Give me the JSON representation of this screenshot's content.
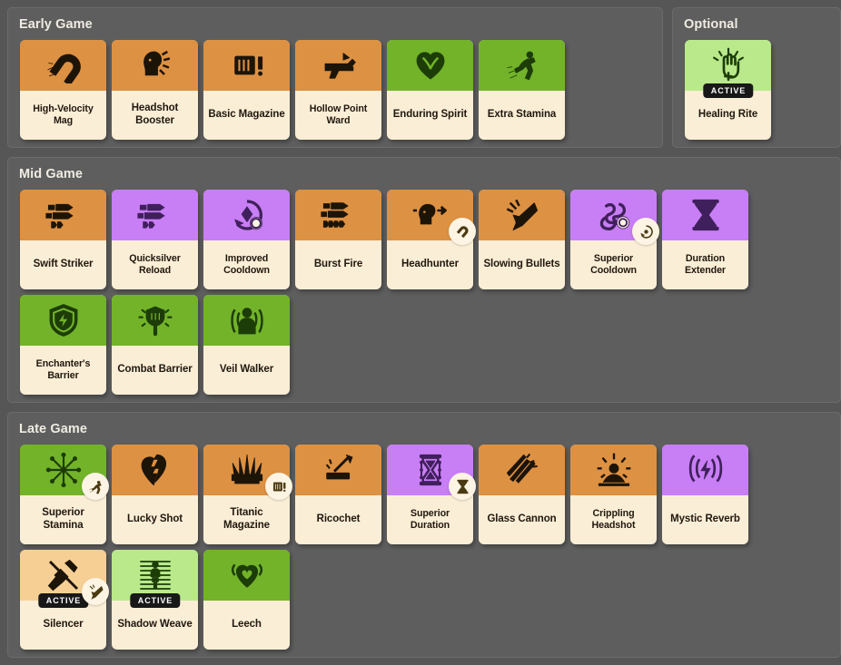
{
  "theme": {
    "page_bg": "#565656",
    "panel_bg": "#5e5e5e",
    "card_body": "#fbeed6",
    "orange": "#dd9142",
    "orange_light": "#f6cf94",
    "green": "#72b32a",
    "green_light": "#b9e98a",
    "purple": "#c87ef5",
    "active_badge_bg": "#181818",
    "title_color": "#f0ece2"
  },
  "active_badge_label": "ACTIVE",
  "sections": [
    {
      "title": "Early Game",
      "cards": [
        {
          "label": "High-Velocity Mag",
          "color": "orange",
          "icon": "magnet-icon",
          "active": false,
          "badge": null
        },
        {
          "label": "Headshot Booster",
          "color": "orange",
          "icon": "head-impact-icon",
          "active": false,
          "badge": null
        },
        {
          "label": "Basic Magazine",
          "color": "orange",
          "icon": "magazine-icon",
          "active": false,
          "badge": null
        },
        {
          "label": "Hollow Point Ward",
          "color": "orange",
          "icon": "pistol-icon",
          "active": false,
          "badge": null
        },
        {
          "label": "Enduring Spirit",
          "color": "green",
          "icon": "heart-icon",
          "active": false,
          "badge": null
        },
        {
          "label": "Extra Stamina",
          "color": "green",
          "icon": "sprint-icon",
          "active": false,
          "badge": null
        }
      ]
    },
    {
      "title": "Optional",
      "cards": [
        {
          "label": "Healing Rite",
          "color": "green_light",
          "icon": "healing-hand-icon",
          "active": true,
          "badge": null
        }
      ]
    },
    {
      "title": "Mid Game",
      "cards": [
        {
          "label": "Swift Striker",
          "color": "orange",
          "icon": "bullets-icon",
          "active": false,
          "badge": null
        },
        {
          "label": "Quicksilver Reload",
          "color": "purple",
          "icon": "bullets-icon",
          "active": false,
          "badge": null
        },
        {
          "label": "Improved Cooldown",
          "color": "purple",
          "icon": "cooldown-icon",
          "active": false,
          "badge": null
        },
        {
          "label": "Burst Fire",
          "color": "orange",
          "icon": "burst-bullets-icon",
          "active": false,
          "badge": null
        },
        {
          "label": "Headhunter",
          "color": "orange",
          "icon": "head-target-icon",
          "active": false,
          "badge": "magnet-icon"
        },
        {
          "label": "Slowing Bullets",
          "color": "orange",
          "icon": "slow-bullet-icon",
          "active": false,
          "badge": null
        },
        {
          "label": "Superior Cooldown",
          "color": "purple",
          "icon": "swirl-icon",
          "active": false,
          "badge": "cooldown-icon"
        },
        {
          "label": "Duration Extender",
          "color": "purple",
          "icon": "hourglass-icon",
          "active": false,
          "badge": null
        },
        {
          "label": "Enchanter's Barrier",
          "color": "green",
          "icon": "shield-bolt-icon",
          "active": false,
          "badge": null
        },
        {
          "label": "Combat Barrier",
          "color": "green",
          "icon": "radiant-shield-icon",
          "active": false,
          "badge": null
        },
        {
          "label": "Veil Walker",
          "color": "green",
          "icon": "stealth-figure-icon",
          "active": false,
          "badge": null
        }
      ]
    },
    {
      "title": "Late Game",
      "cards": [
        {
          "label": "Superior Stamina",
          "color": "green",
          "icon": "burst-stamina-icon",
          "active": false,
          "badge": "sprint-icon"
        },
        {
          "label": "Lucky Shot",
          "color": "orange",
          "icon": "broken-heart-icon",
          "active": false,
          "badge": null
        },
        {
          "label": "Titanic Magazine",
          "color": "orange",
          "icon": "crown-spikes-icon",
          "active": false,
          "badge": "magazine-icon"
        },
        {
          "label": "Ricochet",
          "color": "orange",
          "icon": "ricochet-icon",
          "active": false,
          "badge": null
        },
        {
          "label": "Superior Duration",
          "color": "purple",
          "icon": "ornate-hourglass-icon",
          "active": false,
          "badge": "hourglass-icon"
        },
        {
          "label": "Glass Cannon",
          "color": "orange",
          "icon": "shards-icon",
          "active": false,
          "badge": null
        },
        {
          "label": "Crippling Headshot",
          "color": "orange",
          "icon": "sunburst-head-icon",
          "active": false,
          "badge": null
        },
        {
          "label": "Mystic Reverb",
          "color": "purple",
          "icon": "waves-bolt-icon",
          "active": false,
          "badge": null
        },
        {
          "label": "Silencer",
          "color": "orange_light",
          "icon": "silencer-icon",
          "active": true,
          "badge": "slow-bullet-icon"
        },
        {
          "label": "Shadow Weave",
          "color": "green_light",
          "icon": "shadow-weave-icon",
          "active": true,
          "badge": null
        },
        {
          "label": "Leech",
          "color": "green",
          "icon": "leech-heart-icon",
          "active": false,
          "badge": null
        }
      ]
    }
  ]
}
